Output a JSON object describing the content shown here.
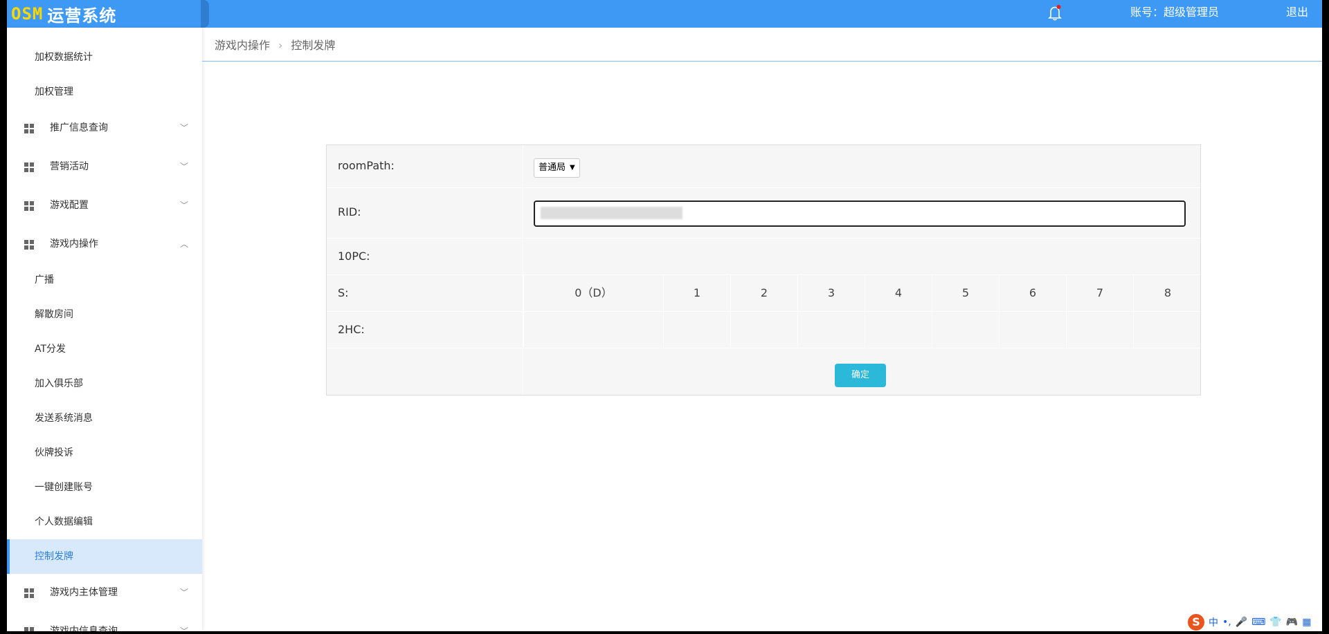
{
  "header": {
    "logo_prefix": "OSM",
    "logo_title": "运营系统",
    "account_label": "账号：超级管理员",
    "logout_label": "退出",
    "brand_color": "#3d99f3"
  },
  "sidebar": {
    "items": [
      {
        "label": "加权数据统计"
      },
      {
        "label": "加权管理"
      },
      {
        "label": "推广信息查询"
      },
      {
        "label": "营销活动"
      },
      {
        "label": "游戏配置"
      },
      {
        "label": "游戏内操作"
      },
      {
        "label": "广播"
      },
      {
        "label": "解散房间"
      },
      {
        "label": "AT分发"
      },
      {
        "label": "加入俱乐部"
      },
      {
        "label": "发送系统消息"
      },
      {
        "label": "伙牌投诉"
      },
      {
        "label": "一键创建账号"
      },
      {
        "label": "个人数据编辑"
      },
      {
        "label": "控制发牌"
      },
      {
        "label": "游戏内主体管理"
      },
      {
        "label": "游戏内信息查询"
      }
    ]
  },
  "breadcrumb": {
    "parent": "游戏内操作",
    "current": "控制发牌"
  },
  "form": {
    "room_path_label": "roomPath:",
    "room_path_value": "普通局",
    "rid_label": "RID:",
    "pc_label": "10PC:",
    "s_label": "S:",
    "hc_label": "2HC:",
    "seats": [
      "0（D）",
      "1",
      "2",
      "3",
      "4",
      "5",
      "6",
      "7",
      "8"
    ],
    "confirm_label": "确定"
  },
  "ime": {
    "label": "中"
  }
}
